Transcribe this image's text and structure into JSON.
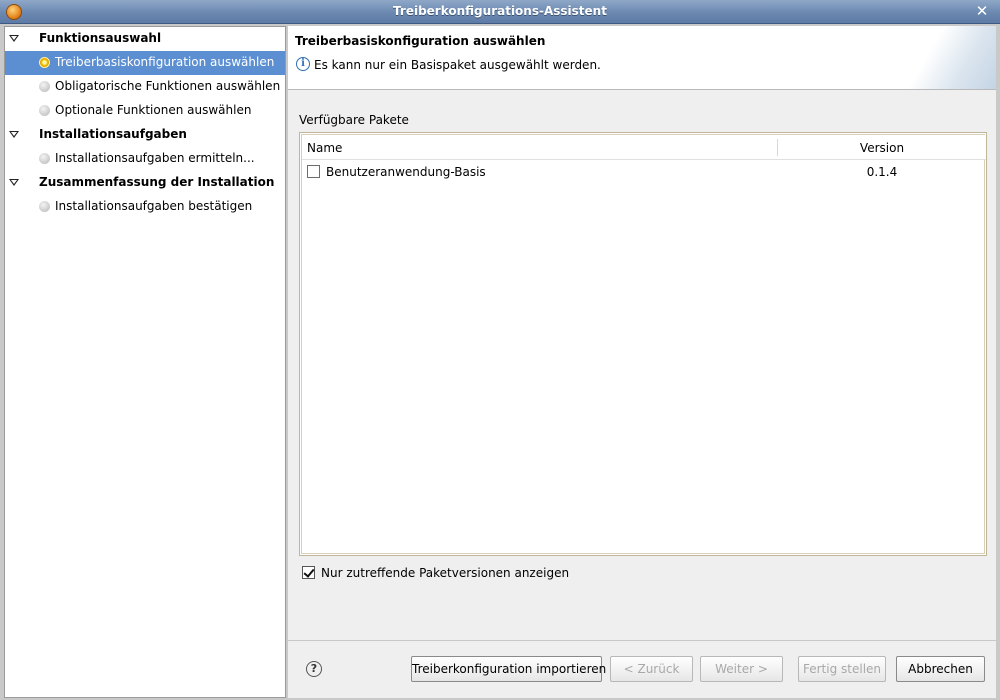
{
  "window": {
    "title": "Treiberkonfigurations-Assistent"
  },
  "nav": {
    "sections": [
      {
        "label": "Funktionsauswahl",
        "items": [
          {
            "label": "Treiberbasiskonfiguration auswählen",
            "selected": true
          },
          {
            "label": "Obligatorische Funktionen auswählen",
            "selected": false
          },
          {
            "label": "Optionale Funktionen auswählen",
            "selected": false
          }
        ]
      },
      {
        "label": "Installationsaufgaben",
        "items": [
          {
            "label": "Installationsaufgaben ermitteln...",
            "selected": false
          }
        ]
      },
      {
        "label": "Zusammenfassung der Installation",
        "items": [
          {
            "label": "Installationsaufgaben bestätigen",
            "selected": false
          }
        ]
      }
    ]
  },
  "page": {
    "title": "Treiberbasiskonfiguration auswählen",
    "info_message": "Es kann nur ein Basispaket ausgewählt werden.",
    "packages_label": "Verfügbare Pakete",
    "table": {
      "columns": [
        "Name",
        "Version"
      ],
      "rows": [
        {
          "name": "Benutzeranwendung-Basis",
          "version": "0.1.4",
          "checked": false
        }
      ]
    },
    "filter_checkbox": {
      "label": "Nur zutreffende Paketversionen anzeigen",
      "checked": true
    }
  },
  "buttons": {
    "import": "Treiberkonfiguration importieren",
    "back": "< Zurück",
    "next": "Weiter >",
    "finish": "Fertig stellen",
    "cancel": "Abbrechen"
  },
  "colors": {
    "selection": "#5b8fd1",
    "titlebar": "#6b88b0",
    "info_icon": "#2f6fb8"
  }
}
